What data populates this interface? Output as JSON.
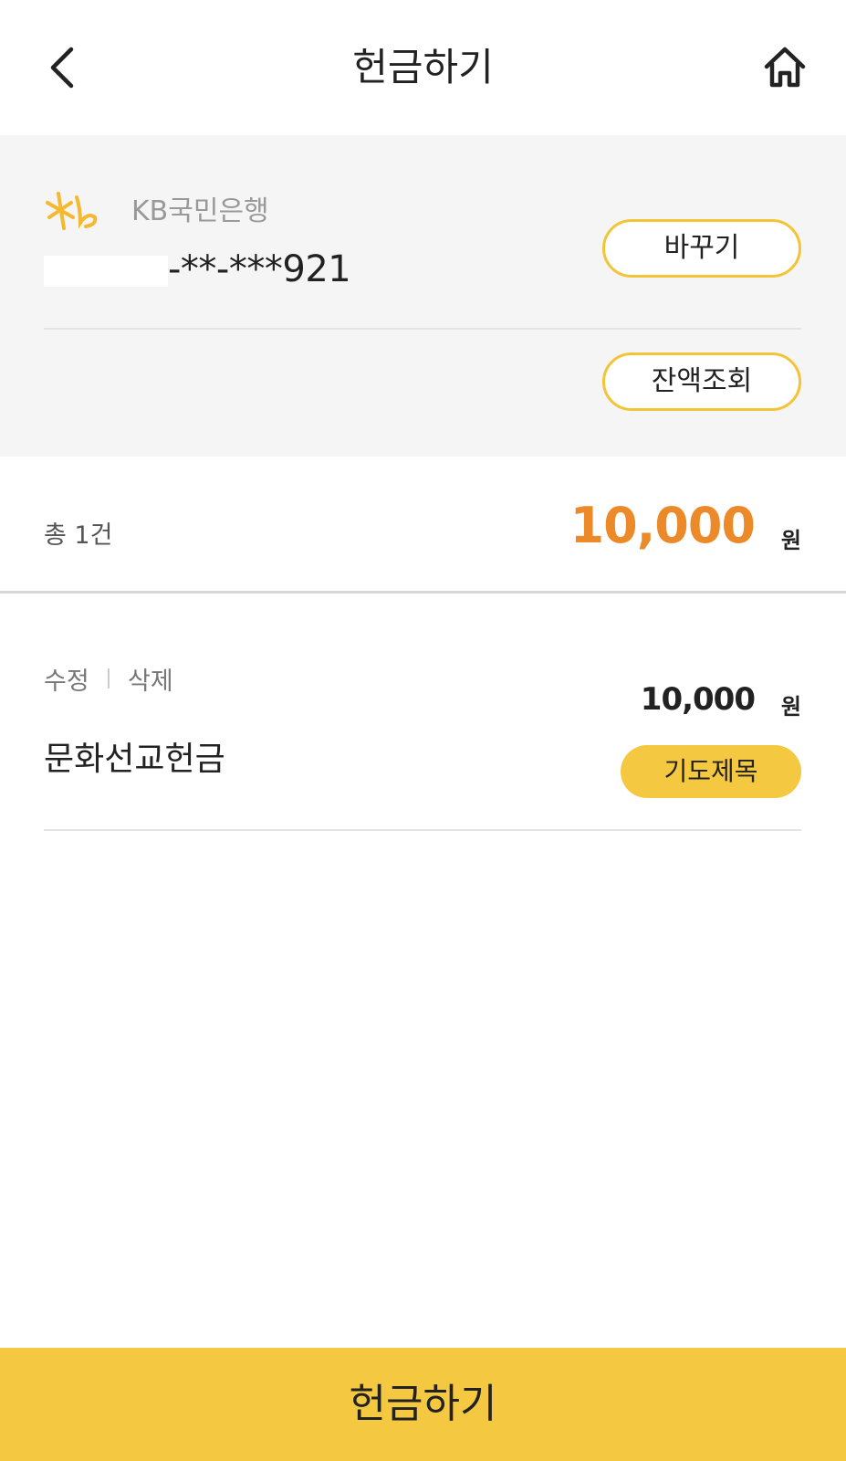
{
  "header": {
    "title": "헌금하기",
    "back_icon": "chevron-left-icon",
    "home_icon": "home-icon"
  },
  "account": {
    "bank_logo": "kb-logo-icon",
    "bank_name": "KB국민은행",
    "account_number": "-**-***921",
    "change_label": "바꾸기",
    "balance_label": "잔액조회"
  },
  "summary": {
    "count_label": "총 1건",
    "total_amount": "10,000",
    "unit": "원"
  },
  "items": [
    {
      "edit_label": "수정",
      "delete_label": "삭제",
      "name": "문화선교헌금",
      "amount": "10,000",
      "unit": "원",
      "prayer_label": "기도제목"
    }
  ],
  "footer": {
    "submit_label": "헌금하기"
  },
  "colors": {
    "accent": "#f5c842",
    "amount_highlight": "#ec8a2a",
    "panel_bg": "#f5f5f5"
  }
}
